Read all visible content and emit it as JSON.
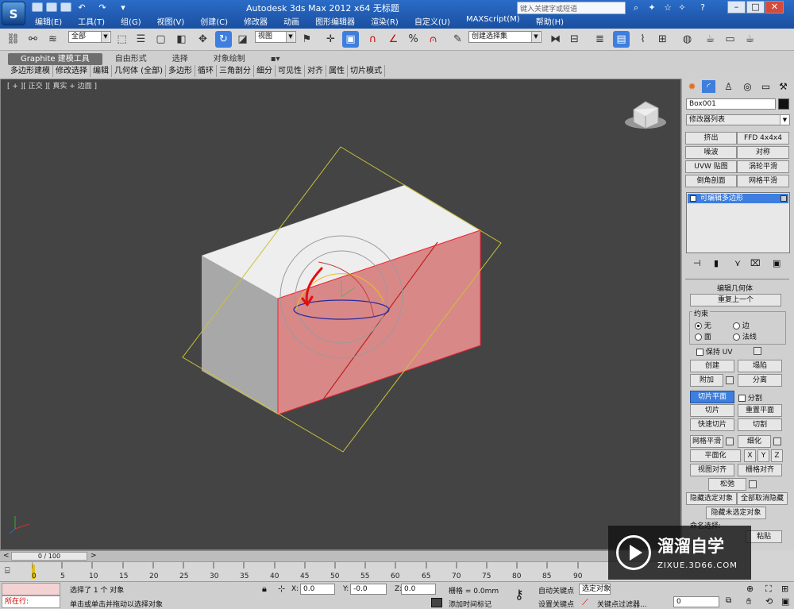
{
  "titlebar": {
    "app_title": "Autodesk 3ds Max  2012 x64    无标题",
    "logo_text": "S",
    "search_placeholder": "键入关键字或短语",
    "menus": [
      "编辑(E)",
      "工具(T)",
      "组(G)",
      "视图(V)",
      "创建(C)",
      "修改器",
      "动画",
      "图形编辑器",
      "渲染(R)",
      "自定义(U)",
      "MAXScript(M)",
      "帮助(H)"
    ],
    "window_buttons": [
      "–",
      "□",
      "✕"
    ]
  },
  "toolbar": {
    "selection_filter": "全部",
    "reference_coord": "视图",
    "named_selection": "创建选择集"
  },
  "ribbon": {
    "tabs": [
      "Graphite 建模工具",
      "自由形式",
      "选择",
      "对象绘制"
    ],
    "panels": [
      "多边形建模",
      "修改选择",
      "编辑",
      "几何体 (全部)",
      "多边形",
      "循环",
      "三角剖分",
      "细分",
      "可见性",
      "对齐",
      "属性",
      "切片模式"
    ]
  },
  "viewport": {
    "label": "[ + ][ 正交 ][ 真实 + 边面 ]"
  },
  "command_panel": {
    "object_name": "Box001",
    "modifier_list": "修改器列表",
    "modifier_buttons": [
      "挤出",
      "FFD 4x4x4",
      "噪波",
      "对称",
      "UVW 贴图",
      "涡轮平滑",
      "倒角剖面",
      "网格平滑"
    ],
    "stack_item": "可编辑多边形",
    "rollout_title": "编辑几何体",
    "repeat_last": "重复上一个",
    "constraints_label": "约束",
    "constraints": [
      "无",
      "边",
      "面",
      "法线"
    ],
    "preserve_uv": "保持 UV",
    "create": "创建",
    "collapse": "塌陷",
    "attach": "附加",
    "detach": "分离",
    "slice_plane": "切片平面",
    "split": "分割",
    "slice": "切片",
    "reset_plane": "重置平面",
    "quickslice": "快速切片",
    "cut": "切割",
    "meshsmooth": "网格平滑",
    "tessellate": "细化",
    "make_planar": "平面化",
    "axes": [
      "X",
      "Y",
      "Z"
    ],
    "view_align": "视图对齐",
    "grid_align": "栅格对齐",
    "relax": "松弛",
    "hide_selected": "隐藏选定对象",
    "unhide_all": "全部取消隐藏",
    "hide_unselected": "隐藏未选定对象",
    "named_selections": "命名选择:",
    "paste": "粘贴"
  },
  "timeline": {
    "frame_counter": "0 / 100",
    "ticks": [
      "0",
      "5",
      "10",
      "15",
      "20",
      "25",
      "30",
      "35",
      "40",
      "45",
      "50",
      "55",
      "60",
      "65",
      "70",
      "75",
      "80",
      "85",
      "90"
    ]
  },
  "status": {
    "running_label": "所在行:",
    "selected_text": "选择了 1 个 对象",
    "prompt_text": "单击或单击并拖动以选择对象",
    "x_value": "0.0",
    "y_value": "-0.0",
    "z_value": "0.0",
    "grid_text": "栅格 = 0.0mm",
    "add_time_tag": "添加时间标记",
    "auto_key": "自动关键点",
    "selected_obj": "选定对象",
    "set_key": "设置关键点",
    "key_filters": "关键点过滤器...",
    "frame_value": "0"
  },
  "watermark": {
    "brand": "溜溜自学",
    "url": "ZIXUE.3D66.COM"
  }
}
